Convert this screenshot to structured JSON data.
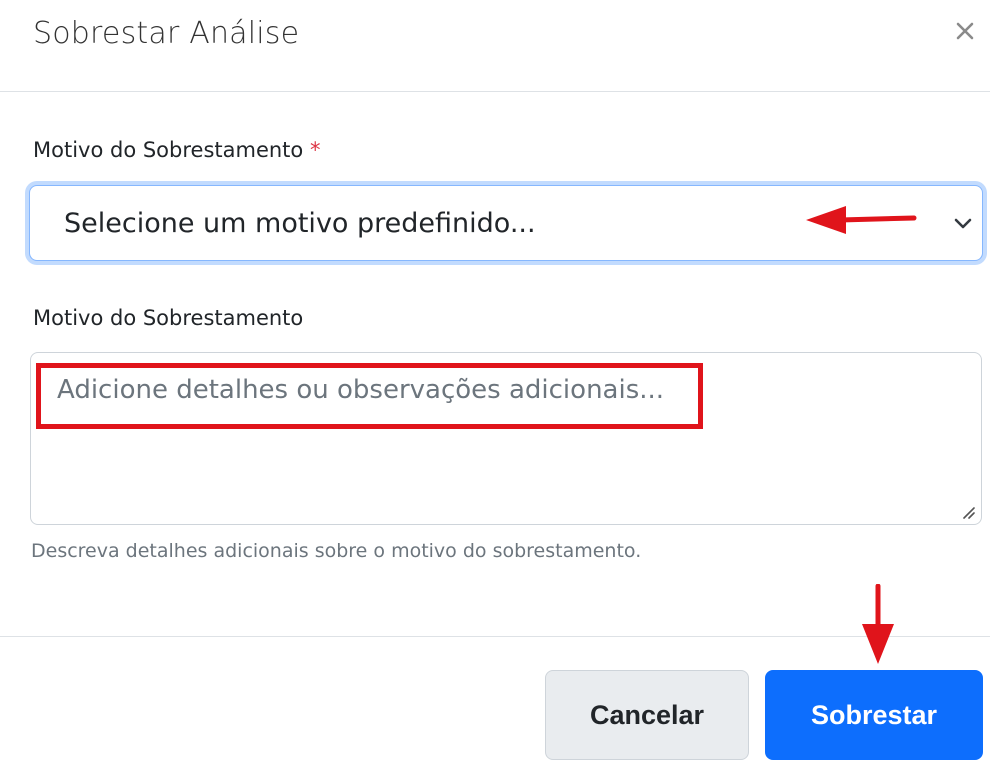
{
  "modal": {
    "title": "Sobrestar Análise",
    "close_icon": "close-icon"
  },
  "form": {
    "reason_select": {
      "label": "Motivo do Sobrestamento",
      "required_marker": "*",
      "selected_value": "Selecione um motivo predefinido...",
      "icon": "chevron-down-icon"
    },
    "details": {
      "label": "Motivo do Sobrestamento",
      "placeholder": "Adicione detalhes ou observações adicionais...",
      "help_text": "Descreva detalhes adicionais sobre o motivo do sobrestamento."
    }
  },
  "footer": {
    "cancel_label": "Cancelar",
    "submit_label": "Sobrestar"
  },
  "annotations": {
    "color": "#e0141b",
    "items": [
      "left-arrow-icon",
      "highlight-box",
      "down-arrow-icon"
    ]
  },
  "colors": {
    "primary": "#0d6efd",
    "focus_ring": "#86b7fe",
    "required": "#dc3545",
    "muted_text": "#6c757d"
  }
}
